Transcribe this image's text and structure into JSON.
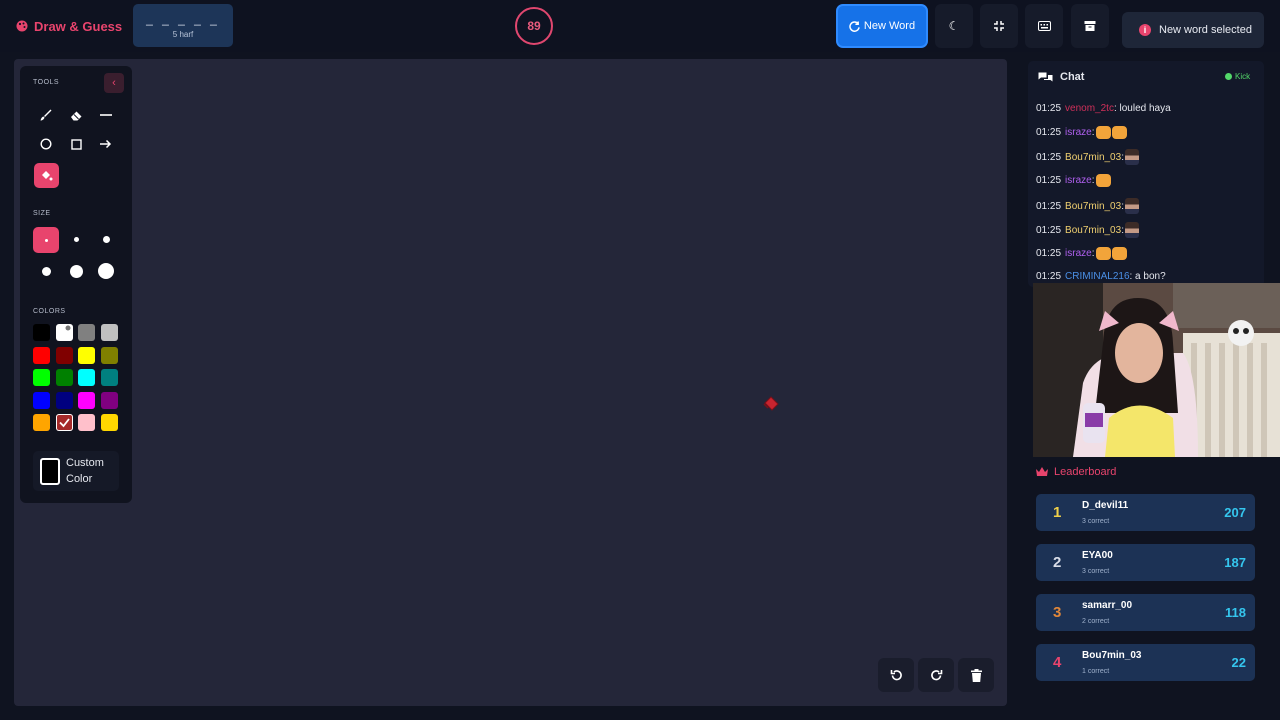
{
  "header": {
    "brand": "Draw & Guess",
    "word_blanks": "_ _ _ _ _",
    "word_length": "5 harf",
    "timer": "89",
    "new_word_label": "New Word",
    "toast": "New word selected"
  },
  "tools_panel": {
    "tools_title": "TOOLS",
    "size_title": "SIZE",
    "colors_title": "COLORS",
    "tools": [
      "brush",
      "eraser",
      "line",
      "circle",
      "rectangle",
      "arrow",
      "fill"
    ],
    "active_tool": "fill",
    "colors": [
      "#000000",
      "#ffffff",
      "#808080",
      "#c0c0c0",
      "#ff0000",
      "#800000",
      "#ffff00",
      "#808000",
      "#00ff00",
      "#008000",
      "#00ffff",
      "#008080",
      "#0000ff",
      "#000080",
      "#ff00ff",
      "#800080",
      "#ffa500",
      "#a52a2a",
      "#ffc0cb",
      "#ffd700"
    ],
    "custom_color_line1": "Custom",
    "custom_color_line2": "Color"
  },
  "chat": {
    "title": "Chat",
    "kick_label": "Kick",
    "messages": [
      {
        "time": "01:25",
        "user": "venom_2tc",
        "user_color": "#d0305a",
        "text": ": louled haya"
      },
      {
        "time": "01:25",
        "user": "israze",
        "user_color": "#b060f0",
        "text": ":"
      },
      {
        "time": "01:25",
        "user": "Bou7min_03",
        "user_color": "#f0d070",
        "text": ":"
      },
      {
        "time": "01:25",
        "user": "israze",
        "user_color": "#b060f0",
        "text": ":"
      },
      {
        "time": "01:25",
        "user": "Bou7min_03",
        "user_color": "#f0d070",
        "text": ":"
      },
      {
        "time": "01:25",
        "user": "Bou7min_03",
        "user_color": "#f0d070",
        "text": ":"
      },
      {
        "time": "01:25",
        "user": "israze",
        "user_color": "#b060f0",
        "text": ":"
      },
      {
        "time": "01:25",
        "user": "CRIMINAL216",
        "user_color": "#4a8fe6",
        "text": ": a bon?"
      }
    ]
  },
  "leaderboard": {
    "title": "Leaderboard",
    "rows": [
      {
        "rank": "1",
        "name": "D_devil11",
        "sub": "3 correct",
        "score": "207",
        "rank_color": "#f0d04a"
      },
      {
        "rank": "2",
        "name": "EYA00",
        "sub": "3 correct",
        "score": "187",
        "rank_color": "#d8dde8"
      },
      {
        "rank": "3",
        "name": "samarr_00",
        "sub": "2 correct",
        "score": "118",
        "rank_color": "#e0873a"
      },
      {
        "rank": "4",
        "name": "Bou7min_03",
        "sub": "1 correct",
        "score": "22",
        "rank_color": "#e8446d"
      }
    ]
  },
  "colors": {
    "accent": "#e8446d",
    "primary_button": "#1672e8",
    "score": "#35c6ee"
  }
}
